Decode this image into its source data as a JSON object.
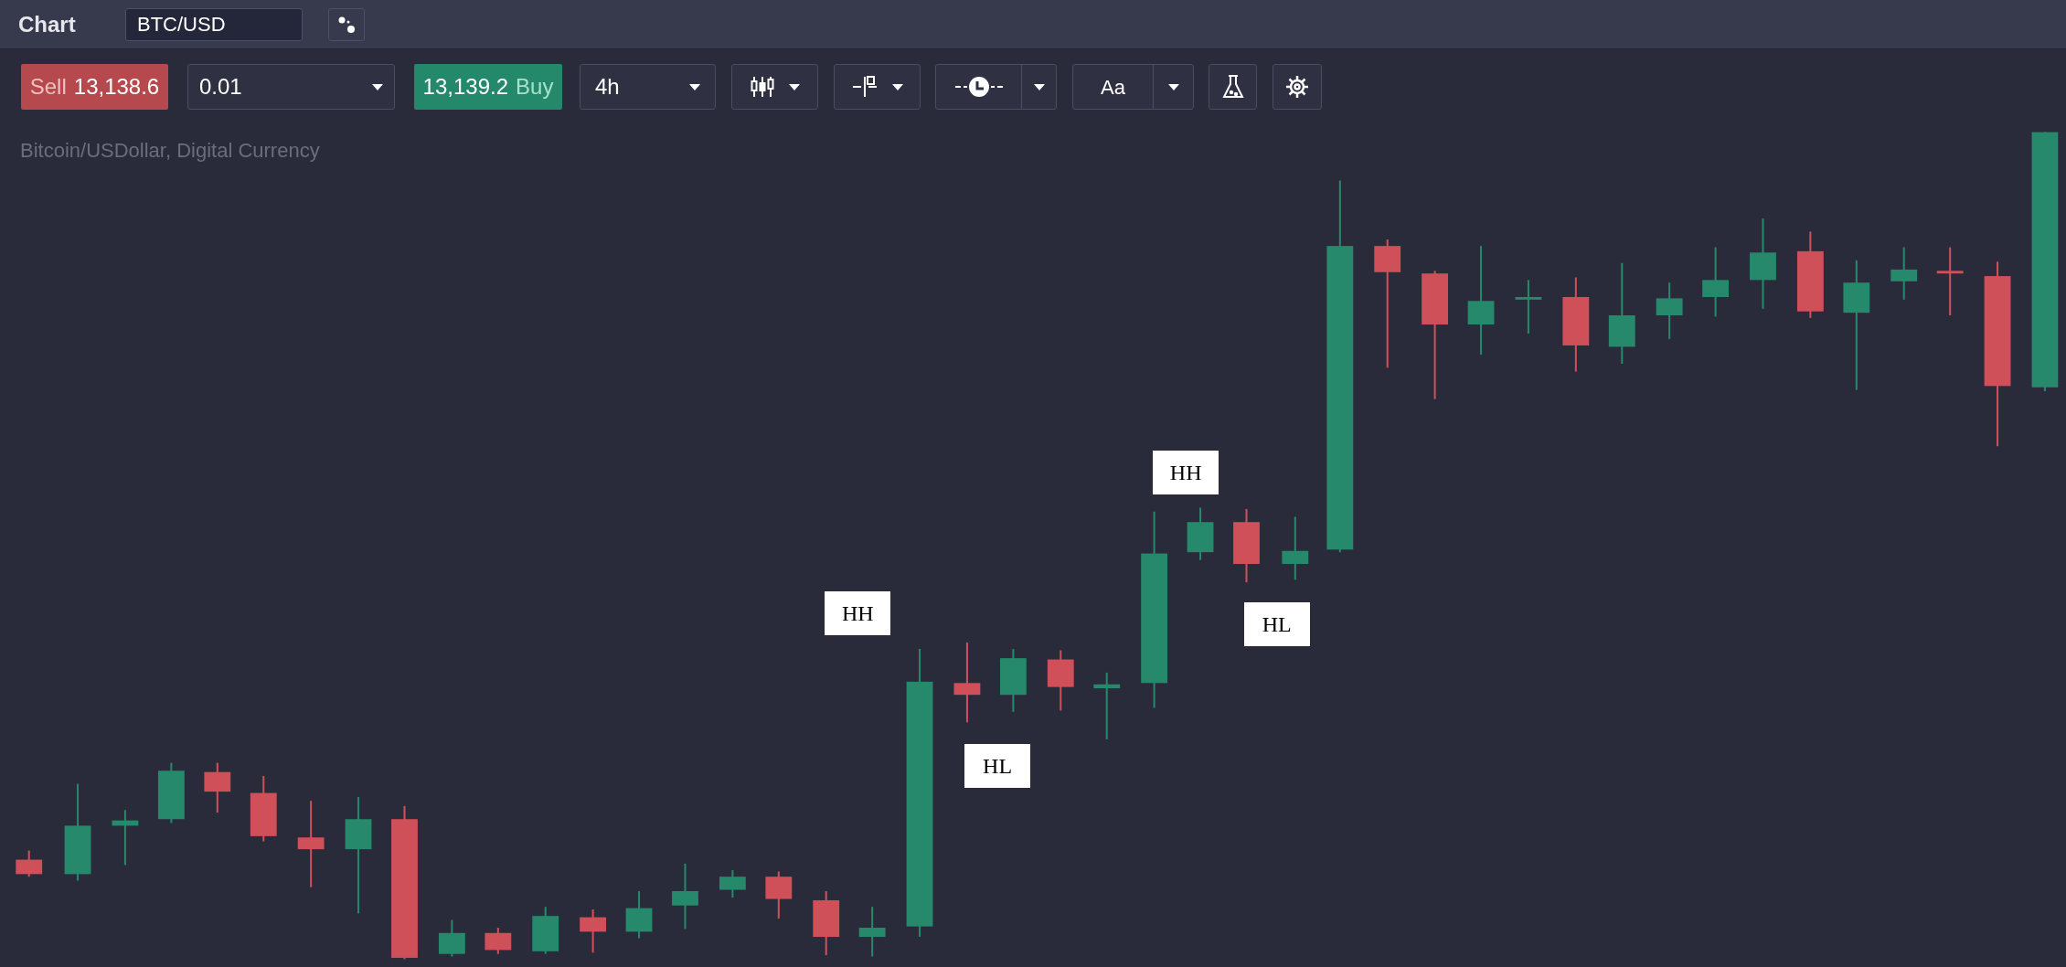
{
  "header": {
    "title": "Chart",
    "symbol": "BTC/USD"
  },
  "toolbar": {
    "sell": {
      "label": "Sell",
      "price": "13,138.6"
    },
    "quantity": {
      "value": "0.01"
    },
    "buy": {
      "price": "13,139.2",
      "label": "Buy"
    },
    "interval": {
      "value": "4h"
    },
    "font_button": {
      "label": "Aa"
    }
  },
  "chart": {
    "subtitle": "Bitcoin/USDollar, Digital Currency",
    "labels": [
      "HH",
      "HL",
      "HH",
      "HL"
    ]
  }
}
